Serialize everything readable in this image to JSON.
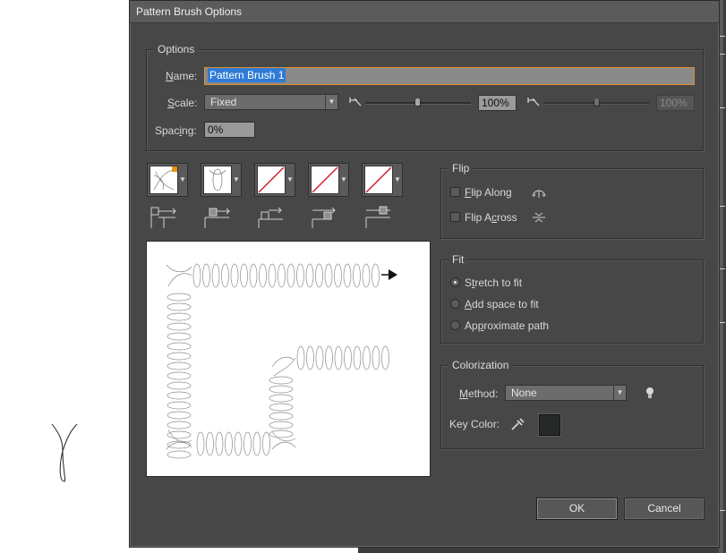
{
  "dialog": {
    "title": "Pattern Brush Options",
    "options_label": "Options",
    "name_label_pre": "",
    "name_label_key": "N",
    "name_label_post": "ame:",
    "name_value": "Pattern Brush 1",
    "scale_label_key": "S",
    "scale_label_post": "cale:",
    "scale_mode": "Fixed",
    "scale_value": "100%",
    "scale_value_max": "100%",
    "scale_level_fraction": 0.5,
    "spacing_label_pre": "Spac",
    "spacing_label_key": "i",
    "spacing_label_post": "ng:",
    "spacing_value": "0%"
  },
  "tiles": [
    {
      "name": "side-tile",
      "state": "pattern"
    },
    {
      "name": "outer-corner-tile",
      "state": "pattern"
    },
    {
      "name": "inner-corner-tile",
      "state": "none"
    },
    {
      "name": "start-tile",
      "state": "none"
    },
    {
      "name": "end-tile",
      "state": "none"
    }
  ],
  "flip": {
    "label": "Flip",
    "along_key": "F",
    "along_post": "lip Along",
    "across_pre": "Flip A",
    "across_key": "c",
    "across_post": "ross"
  },
  "fit": {
    "label": "Fit",
    "stretch_pre": "S",
    "stretch_key": "t",
    "stretch_post": "retch to fit",
    "add_key": "A",
    "add_post": "dd space to fit",
    "approx_pre": "Ap",
    "approx_key": "p",
    "approx_post": "roximate path",
    "selected": "stretch"
  },
  "colorization": {
    "label": "Colorization",
    "method_key": "M",
    "method_post": "ethod:",
    "method_value": "None",
    "key_color_label": "Key Color:",
    "key_color_hex": "#252a28"
  },
  "buttons": {
    "ok": "OK",
    "cancel": "Cancel"
  },
  "icons": {
    "eyedropper": "eyedropper-icon",
    "tip": "lightbulb-icon",
    "flip_along": "flip-along-icon",
    "flip_across": "flip-across-icon"
  }
}
